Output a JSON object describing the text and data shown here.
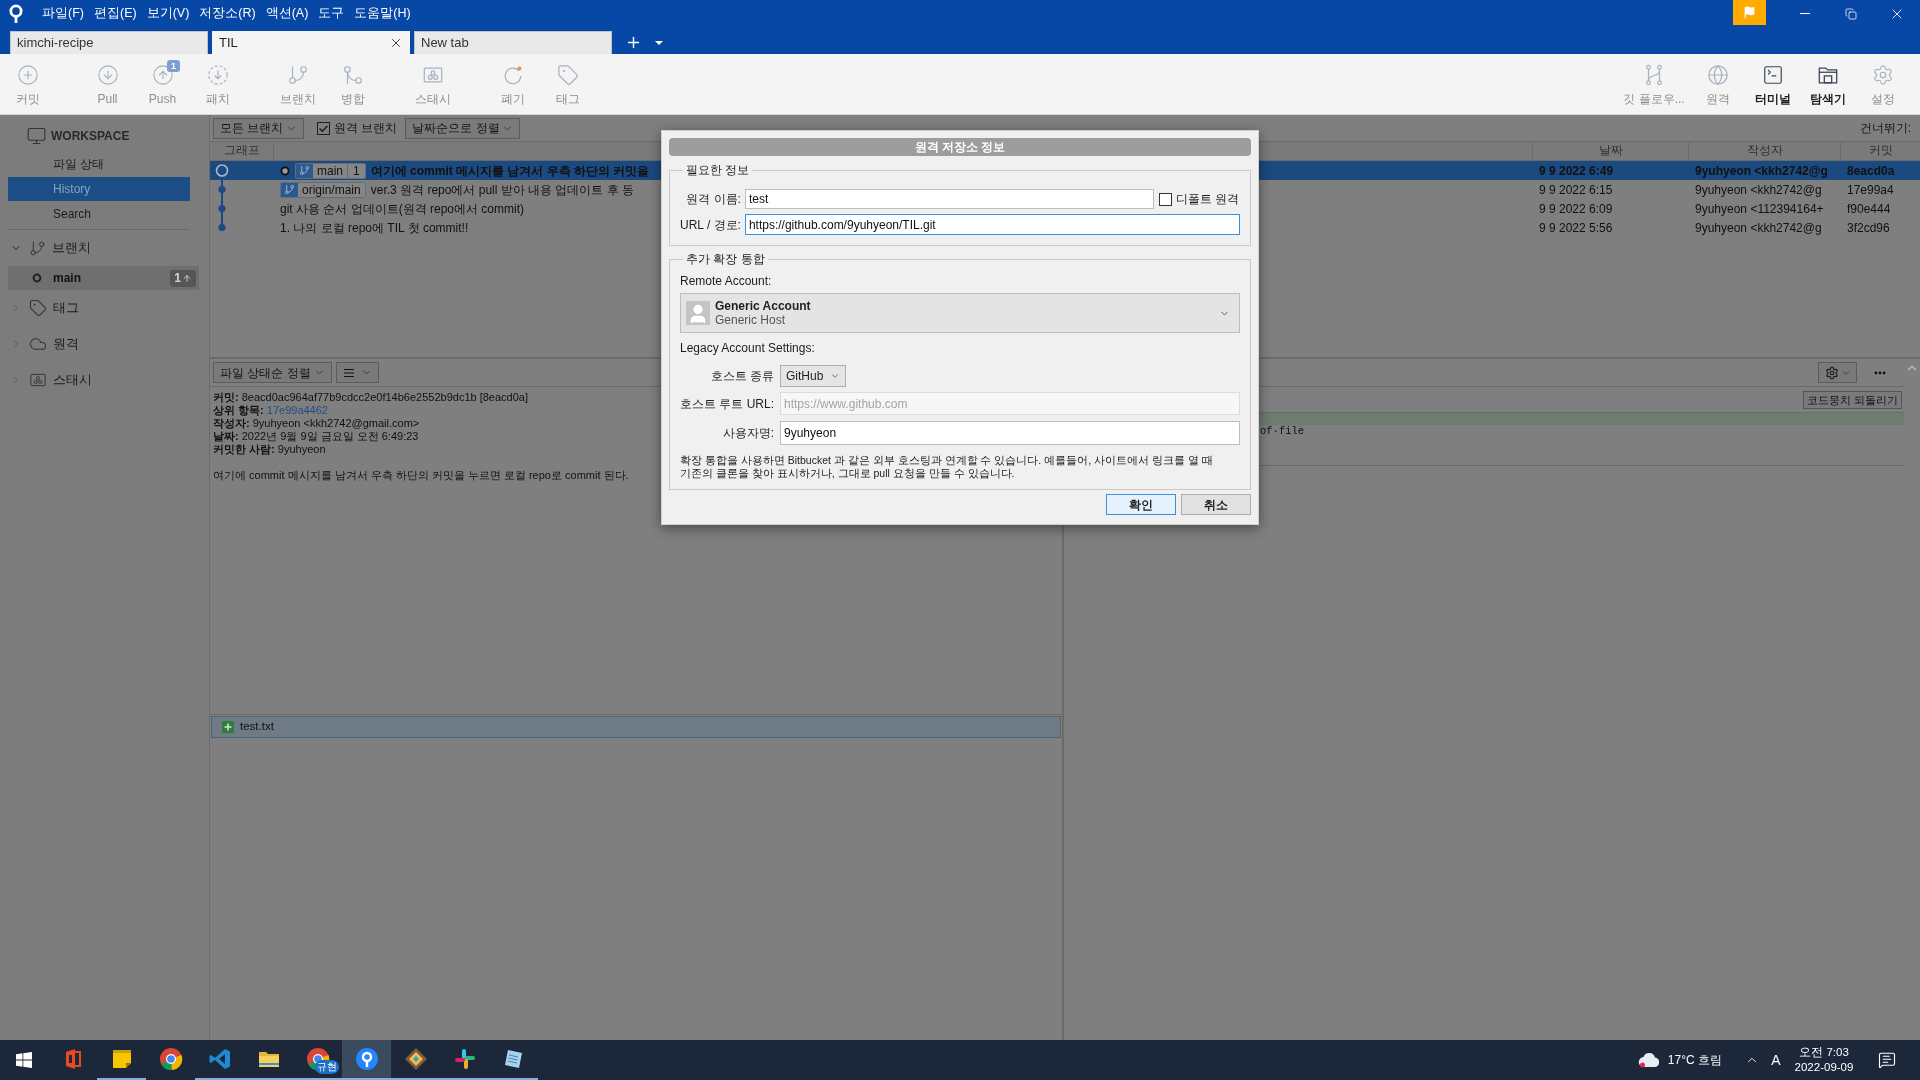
{
  "title_bar": {
    "menus": [
      "파일(F)",
      "편집(E)",
      "보기(V)",
      "저장소(R)",
      "액션(A)",
      "도구",
      "도움말(H)"
    ],
    "tabs": [
      {
        "label": "kimchi-recipe",
        "selected": false,
        "closable": false
      },
      {
        "label": "TIL",
        "selected": true,
        "closable": true
      },
      {
        "label": "New tab",
        "selected": false,
        "closable": false
      }
    ]
  },
  "toolbar": {
    "groups": [
      [
        {
          "label": "커밋",
          "disabled": true
        }
      ],
      [
        {
          "label": "Pull",
          "disabled": true
        },
        {
          "label": "Push",
          "disabled": true,
          "badge": "1"
        },
        {
          "label": "패치",
          "disabled": true
        }
      ],
      [
        {
          "label": "브랜치",
          "disabled": true
        },
        {
          "label": "병합",
          "disabled": true
        }
      ],
      [
        {
          "label": "스태시",
          "disabled": true
        }
      ],
      [
        {
          "label": "폐기",
          "disabled": true
        },
        {
          "label": "태그",
          "disabled": true
        }
      ]
    ],
    "right": [
      {
        "label": "깃 플로우...",
        "disabled": true
      },
      {
        "label": "원격",
        "disabled": true
      },
      {
        "label": "터미널",
        "disabled": false
      },
      {
        "label": "탐색기",
        "disabled": false
      },
      {
        "label": "설정",
        "disabled": true
      }
    ]
  },
  "sidebar": {
    "workspace": {
      "title": "WORKSPACE",
      "items": [
        {
          "label": "파일 상태",
          "selected": false
        },
        {
          "label": "History",
          "selected": true
        },
        {
          "label": "Search",
          "selected": false
        }
      ]
    },
    "sections": [
      {
        "label": "브랜치",
        "expanded": true,
        "children": [
          {
            "label": "main",
            "selected": true,
            "current": true,
            "badge": "1"
          }
        ]
      },
      {
        "label": "태그",
        "expanded": false
      },
      {
        "label": "원격",
        "expanded": false
      },
      {
        "label": "스태시",
        "expanded": false
      }
    ]
  },
  "commit_view": {
    "filter": {
      "branches": "모든 브랜치",
      "remote_branches": {
        "label": "원격 브랜치",
        "checked": true
      },
      "sort": "날짜순으로 정렬",
      "jump": "건너뛰기:"
    },
    "columns": [
      "그래프",
      "날짜",
      "작성자",
      "커밋"
    ],
    "rows": [
      {
        "selected": true,
        "head": true,
        "refs": [
          {
            "label": "main",
            "badge": "1"
          }
        ],
        "message": "여기에 commit 메시지를 남겨서 우측 하단의 커밋을",
        "date": "9 9 2022 6:49",
        "author": "9yuhyeon <kkh2742@g",
        "commit": "8eacd0a"
      },
      {
        "selected": false,
        "head": false,
        "refs": [
          {
            "label": "origin/main"
          }
        ],
        "message": "ver.3 원격 repo에서 pull 받아 내용 업데이트 후 동",
        "date": "9 9 2022 6:15",
        "author": "9yuhyeon <kkh2742@g",
        "commit": "17e99a4"
      },
      {
        "selected": false,
        "head": false,
        "message": "git 사용 순서 업데이트(원격 repo에서 commit)",
        "date": "9 9 2022 6:09",
        "author": "9yuhyeon <112394164+",
        "commit": "f90e444"
      },
      {
        "selected": false,
        "head": false,
        "message": "1. 나의 로컬 repo에 TIL 첫 commit!!",
        "date": "9 9 2022 5:56",
        "author": "9yuhyeon <kkh2742@g",
        "commit": "3f2cd96"
      }
    ]
  },
  "details": {
    "sort": "파일 상태순 정렬",
    "lines": [
      {
        "label": "커밋:",
        "value": "8eacd0ac964af77b9cdcc2e0f14b6e2552b9dc1b [8eacd0a]",
        "link": false
      },
      {
        "label": "상위 항목:",
        "value": "17e99a4462",
        "link": true
      },
      {
        "label": "작성자:",
        "value": "9yuhyeon <kkh2742@gmail.com>",
        "link": false
      },
      {
        "label": "날짜:",
        "value": "2022년 9월 9일 금요일 오전 6:49:23",
        "link": false
      },
      {
        "label": "커밋한 사람:",
        "value": "9yuhyeon",
        "link": false
      }
    ],
    "message": "여기에 commit 메시지를 남겨서 우측 하단의 커밋을 누르면 로컬 repo로 commit 된다.",
    "files": [
      {
        "name": "test.txt",
        "kind": "added",
        "selected": true
      }
    ]
  },
  "diff": {
    "discard_hunk": "코드뭉치 되돌리기",
    "lines": [
      {
        "kind": "added"
      },
      {
        "kind": "context",
        "text": "of·file"
      }
    ]
  },
  "dialog": {
    "title": "원격 저장소 정보",
    "required": {
      "legend": "필요한 정보",
      "name": {
        "label": "원격 이름:",
        "value": "test",
        "focused": false
      },
      "default_remote": {
        "label": "디폴트 원격",
        "checked": false
      },
      "url": {
        "label": "URL / 경로:",
        "value": "https://github.com/9yuhyeon/TIL.git",
        "focused": true
      }
    },
    "integration": {
      "legend": "추가 확장 통합",
      "account_label": "Remote Account:",
      "account": {
        "name": "Generic Account",
        "host": "Generic Host"
      },
      "legacy_label": "Legacy Account Settings:",
      "host_type": {
        "label": "호스트 종류",
        "value": "GitHub"
      },
      "host_root": {
        "label": "호스트 루트 URL:",
        "value": "https://www.github.com",
        "disabled": true
      },
      "username": {
        "label": "사용자명:",
        "value": "9yuhyeon",
        "disabled": false
      },
      "help": "확장 통합을 사용하면 Bitbucket 과 같은 외부 호스팅과 연계할 수 있습니다. 예를들어, 사이트에서 링크를 열 때 기존의 클론을 찾아 표시하거나, 그대로 pull 요청을 만들 수 있습니다."
    },
    "buttons": [
      {
        "label": "확인",
        "default": true
      },
      {
        "label": "취소",
        "default": false
      }
    ]
  },
  "taskbar": {
    "apps": [
      {
        "running": false,
        "selected": false
      },
      {
        "running": true,
        "selected": false
      },
      {
        "running": false,
        "selected": false
      },
      {
        "running": true,
        "selected": false
      },
      {
        "running": true,
        "selected": false
      },
      {
        "running": true,
        "selected": false,
        "badge": "규현"
      },
      {
        "running": true,
        "selected": true
      },
      {
        "running": true,
        "selected": false
      },
      {
        "running": true,
        "selected": false
      },
      {
        "running": true,
        "selected": false
      }
    ],
    "weather": "17°C 흐림",
    "input_mode": "A",
    "time": "오전 7:03",
    "date": "2022-09-09"
  }
}
